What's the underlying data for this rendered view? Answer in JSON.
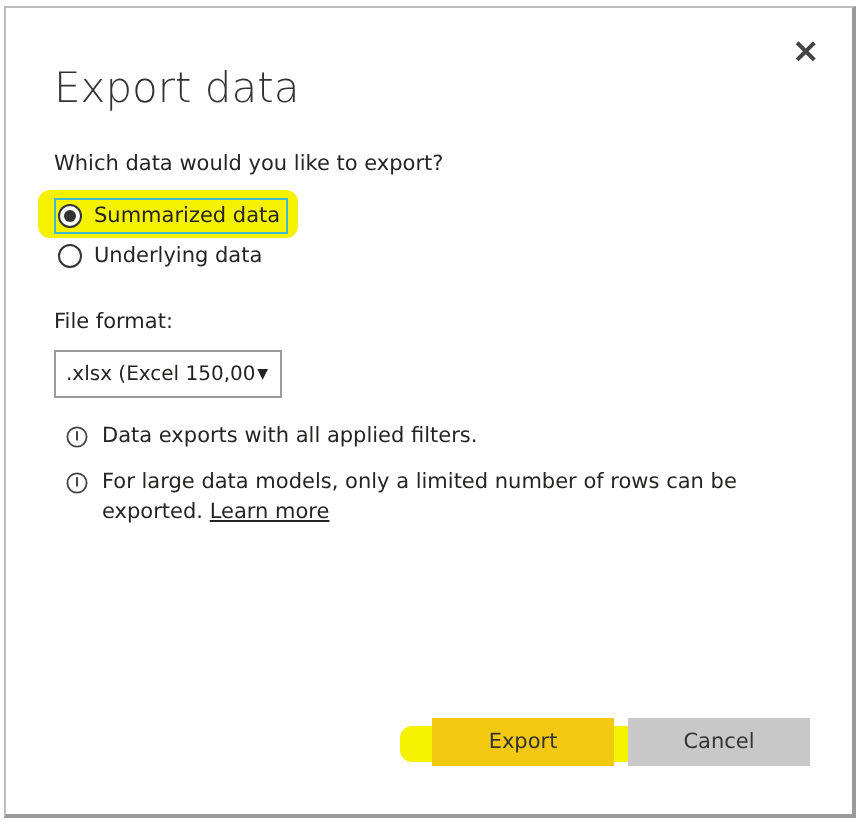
{
  "dialog": {
    "title": "Export data",
    "close": "×"
  },
  "question": "Which data would you like to export?",
  "options": [
    {
      "label": "Summarized data",
      "selected": true,
      "highlighted": true
    },
    {
      "label": "Underlying data",
      "selected": false,
      "highlighted": false
    }
  ],
  "format": {
    "label": "File format:",
    "value": ".xlsx (Excel 150,00",
    "arrow": "▼"
  },
  "notes": [
    {
      "text": "Data exports with all applied filters."
    },
    {
      "text": "For large data models, only a limited number of rows can be exported.",
      "link": "Learn more"
    }
  ],
  "buttons": [
    {
      "label": "Export",
      "kind": "primary",
      "highlighted": true
    },
    {
      "label": "Cancel",
      "kind": "secondary",
      "highlighted": false
    }
  ]
}
